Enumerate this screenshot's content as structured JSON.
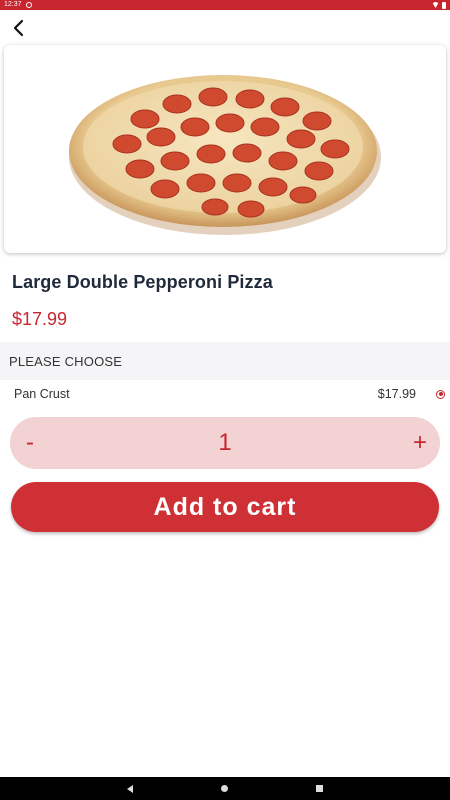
{
  "status_bar": {
    "time": "12:37",
    "left_icons": [
      "notification-icon"
    ],
    "right_icons": [
      "wifi-icon",
      "battery-icon"
    ]
  },
  "header": {
    "back_icon": "chevron-left-icon"
  },
  "product": {
    "image_icon": "pizza-image",
    "title": "Large Double Pepperoni Pizza",
    "price": "$17.99"
  },
  "options": {
    "section_title": "PLEASE CHOOSE",
    "items": [
      {
        "name": "Pan Crust",
        "price": "$17.99",
        "selected": true
      }
    ]
  },
  "quantity": {
    "minus_label": "-",
    "value": "1",
    "plus_label": "+"
  },
  "cart": {
    "add_label": "Add to cart"
  },
  "nav_bar": {
    "icons": [
      "back-icon",
      "home-icon",
      "recents-icon"
    ]
  },
  "colors": {
    "accent": "#c8262f",
    "stepper_bg": "#f2d2d3",
    "title": "#1f2a3a"
  }
}
